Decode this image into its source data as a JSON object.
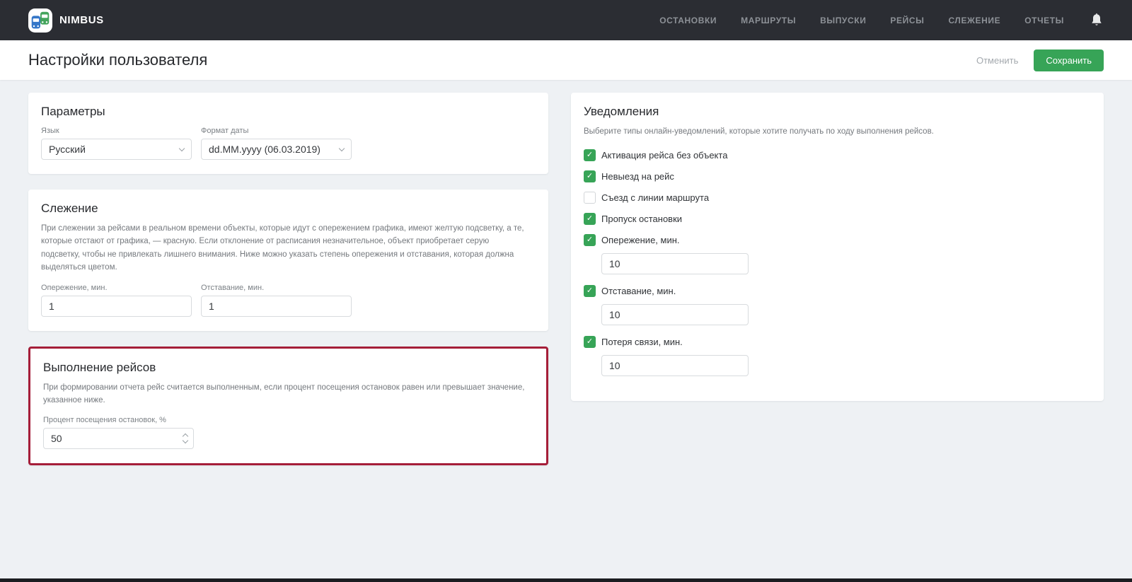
{
  "navbar": {
    "brand": "NIMBUS",
    "items": [
      {
        "label": "ОСТАНОВКИ"
      },
      {
        "label": "МАРШРУТЫ"
      },
      {
        "label": "ВЫПУСКИ"
      },
      {
        "label": "РЕЙСЫ"
      },
      {
        "label": "СЛЕЖЕНИЕ"
      },
      {
        "label": "ОТЧЕТЫ"
      }
    ],
    "bell_icon": "notifications-bell"
  },
  "header": {
    "title": "Настройки пользователя",
    "cancel_label": "Отменить",
    "save_label": "Сохранить"
  },
  "cards": {
    "parameters": {
      "title": "Параметры",
      "language_label": "Язык",
      "language_value": "Русский",
      "date_format_label": "Формат даты",
      "date_format_value": "dd.MM.yyyy (06.03.2019)"
    },
    "tracking": {
      "title": "Слежение",
      "description": "При слежении за рейсами в реальном времени объекты, которые идут с опережением графика, имеют желтую подсветку, а те, которые отстают от графика, — красную. Если отклонение от расписания незначительное, объект приобретает серую подсветку, чтобы не привлекать лишнего внимания. Ниже можно указать степень опережения и отставания, которая должна выделяться цветом.",
      "lead_label": "Опережение, мин.",
      "lead_value": "1",
      "lag_label": "Отставание, мин.",
      "lag_value": "1"
    },
    "trip_execution": {
      "title": "Выполнение рейсов",
      "description": "При формировании отчета рейс считается выполненным, если процент посещения остановок равен или превышает значение, указанное ниже.",
      "percent_label": "Процент посещения остановок, %",
      "percent_value": "50"
    },
    "notifications": {
      "title": "Уведомления",
      "description": "Выберите типы онлайн-уведомлений, которые хотите получать по ходу выполнения рейсов.",
      "items": [
        {
          "label": "Активация рейса без объекта",
          "checked": true
        },
        {
          "label": "Невыезд на рейс",
          "checked": true
        },
        {
          "label": "Съезд с линии маршрута",
          "checked": false
        },
        {
          "label": "Пропуск остановки",
          "checked": true
        },
        {
          "label": "Опережение, мин.",
          "checked": true,
          "value": "10"
        },
        {
          "label": "Отставание, мин.",
          "checked": true,
          "value": "10"
        },
        {
          "label": "Потеря связи, мин.",
          "checked": true,
          "value": "10"
        }
      ]
    }
  },
  "colors": {
    "accent_green": "#37a457",
    "highlight_border_red": "#a51e39",
    "navbar_bg": "#2b2d33",
    "body_bg": "#eef1f4"
  }
}
